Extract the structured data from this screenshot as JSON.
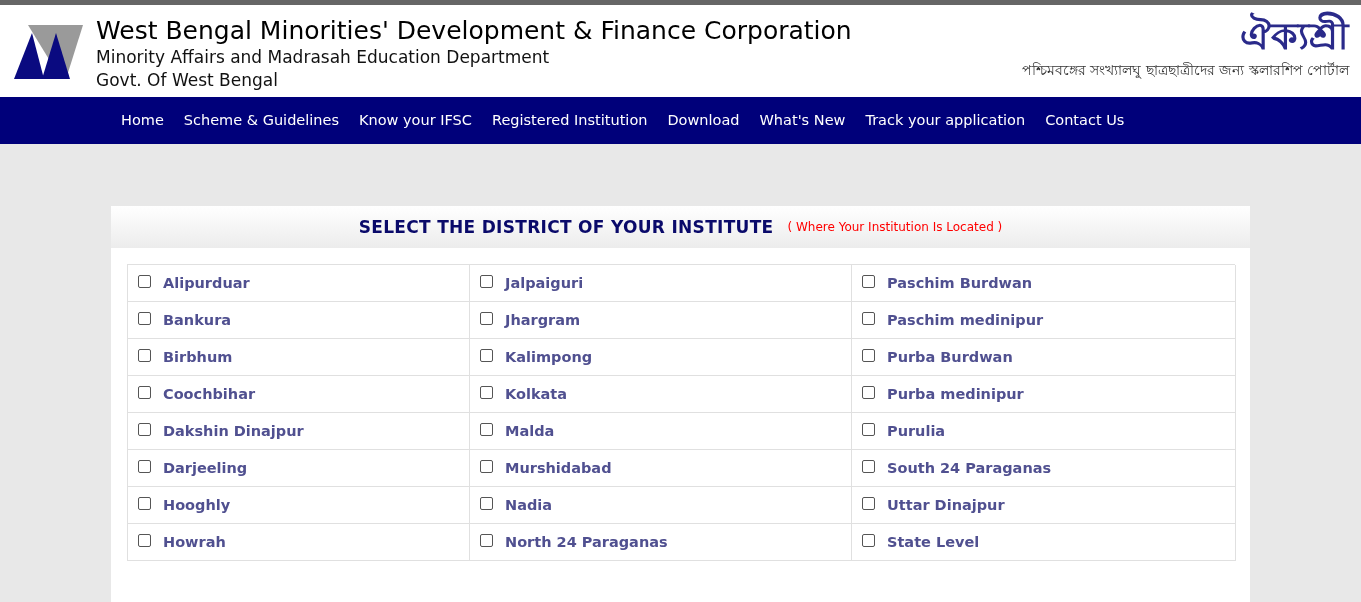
{
  "header": {
    "title": "West Bengal Minorities' Development & Finance Corporation",
    "subtitle": "Minority Affairs and Madrasah Education Department",
    "government": "Govt. Of West Bengal",
    "portal_name": "ঐক্যশ্রী",
    "portal_tagline": "পশ্চিমবঙ্গের সংখ্যালঘু ছাত্রছাত্রীদের জন্য স্কলারশিপ পোর্টাল"
  },
  "nav": [
    "Home",
    "Scheme & Guidelines",
    "Know your IFSC",
    "Registered Institution",
    "Download",
    "What's New",
    "Track your application",
    "Contact Us"
  ],
  "panel": {
    "title": "SELECT THE DISTRICT OF YOUR INSTITUTE",
    "note": "( Where Your Institution Is Located )"
  },
  "districts": [
    [
      {
        "name": "Alipurduar",
        "checked": false
      },
      {
        "name": "Bankura",
        "checked": false
      },
      {
        "name": "Birbhum",
        "checked": false
      },
      {
        "name": "Coochbihar",
        "checked": false
      },
      {
        "name": "Dakshin Dinajpur",
        "checked": false
      },
      {
        "name": "Darjeeling",
        "checked": false
      },
      {
        "name": "Hooghly",
        "checked": false
      },
      {
        "name": "Howrah",
        "checked": false
      }
    ],
    [
      {
        "name": "Jalpaiguri",
        "checked": false
      },
      {
        "name": "Jhargram",
        "checked": false
      },
      {
        "name": "Kalimpong",
        "checked": false
      },
      {
        "name": "Kolkata",
        "checked": false
      },
      {
        "name": "Malda",
        "checked": false
      },
      {
        "name": "Murshidabad",
        "checked": false
      },
      {
        "name": "Nadia",
        "checked": false
      },
      {
        "name": "North 24 Paraganas",
        "checked": false
      }
    ],
    [
      {
        "name": "Paschim Burdwan",
        "checked": false
      },
      {
        "name": "Paschim medinipur",
        "checked": false
      },
      {
        "name": "Purba Burdwan",
        "checked": false
      },
      {
        "name": "Purba medinipur",
        "checked": false
      },
      {
        "name": "Purulia",
        "checked": false
      },
      {
        "name": "South 24 Paraganas",
        "checked": false
      },
      {
        "name": "Uttar Dinajpur",
        "checked": false
      },
      {
        "name": "State Level",
        "checked": false
      }
    ]
  ]
}
